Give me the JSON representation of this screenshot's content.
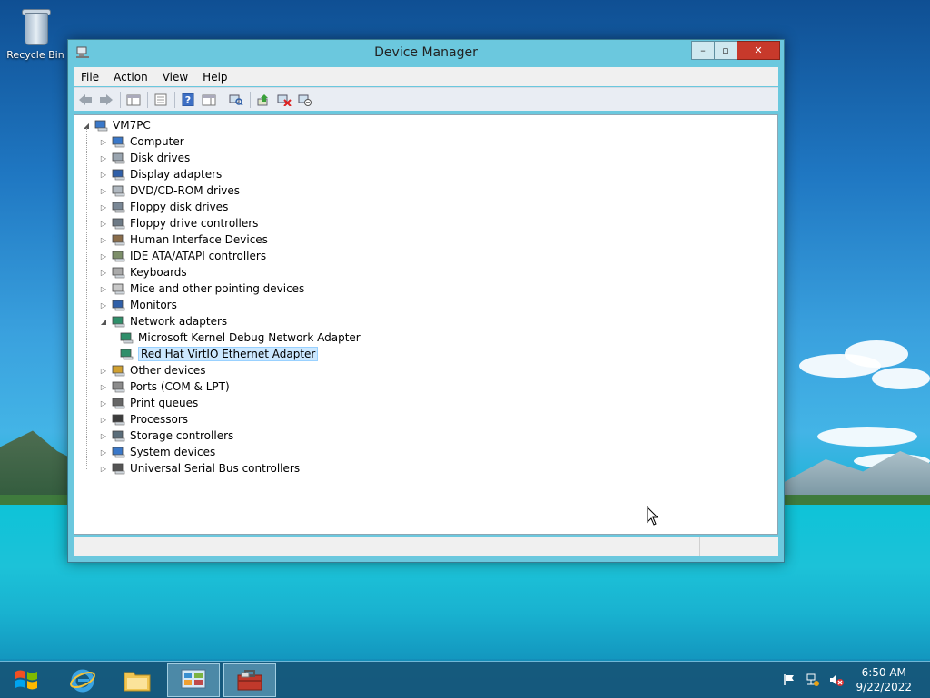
{
  "desktop": {
    "recycle_bin_label": "Recycle Bin"
  },
  "window": {
    "title": "Device Manager",
    "controls": {
      "minimize": "–",
      "maximize": "▫",
      "close": "✕"
    }
  },
  "menu": {
    "items": [
      "File",
      "Action",
      "View",
      "Help"
    ]
  },
  "toolbar": {
    "buttons": [
      "back-icon",
      "forward-icon",
      "show-hide-console-tree-icon",
      "properties-icon",
      "help-icon",
      "console-view-icon",
      "scan-hardware-icon",
      "update-driver-icon",
      "uninstall-icon",
      "disable-device-icon"
    ]
  },
  "tree": {
    "root": "VM7PC",
    "categories": [
      {
        "label": "Computer",
        "icon": "computer-icon"
      },
      {
        "label": "Disk drives",
        "icon": "disk-drive-icon"
      },
      {
        "label": "Display adapters",
        "icon": "display-adapter-icon"
      },
      {
        "label": "DVD/CD-ROM drives",
        "icon": "dvd-drive-icon"
      },
      {
        "label": "Floppy disk drives",
        "icon": "floppy-disk-icon"
      },
      {
        "label": "Floppy drive controllers",
        "icon": "floppy-controller-icon"
      },
      {
        "label": "Human Interface Devices",
        "icon": "hid-icon"
      },
      {
        "label": "IDE ATA/ATAPI controllers",
        "icon": "ide-controller-icon"
      },
      {
        "label": "Keyboards",
        "icon": "keyboard-icon"
      },
      {
        "label": "Mice and other pointing devices",
        "icon": "mouse-icon"
      },
      {
        "label": "Monitors",
        "icon": "monitor-icon"
      },
      {
        "label": "Network adapters",
        "icon": "network-adapter-icon",
        "expanded": true,
        "children": [
          {
            "label": "Microsoft Kernel Debug Network Adapter",
            "icon": "network-adapter-icon"
          },
          {
            "label": "Red Hat VirtIO Ethernet Adapter",
            "icon": "network-adapter-icon",
            "selected": true
          }
        ]
      },
      {
        "label": "Other devices",
        "icon": "unknown-device-icon"
      },
      {
        "label": "Ports (COM & LPT)",
        "icon": "port-icon"
      },
      {
        "label": "Print queues",
        "icon": "printer-icon"
      },
      {
        "label": "Processors",
        "icon": "processor-icon"
      },
      {
        "label": "Storage controllers",
        "icon": "storage-controller-icon"
      },
      {
        "label": "System devices",
        "icon": "system-device-icon"
      },
      {
        "label": "Universal Serial Bus controllers",
        "icon": "usb-icon"
      }
    ]
  },
  "taskbar": {
    "buttons": [
      {
        "name": "internet-explorer",
        "active": false
      },
      {
        "name": "file-explorer",
        "active": false
      },
      {
        "name": "control-panel",
        "active": true
      },
      {
        "name": "device-manager",
        "active": true
      }
    ],
    "tray_icons": [
      "action-center-flag-icon",
      "network-icon",
      "volume-muted-icon"
    ],
    "time": "6:50 AM",
    "date": "9/22/2022"
  },
  "colors": {
    "selection_bg": "#cce8ff",
    "selection_border": "#99d1ff",
    "close_button": "#c7392b",
    "window_frame": "#6bc8de"
  }
}
